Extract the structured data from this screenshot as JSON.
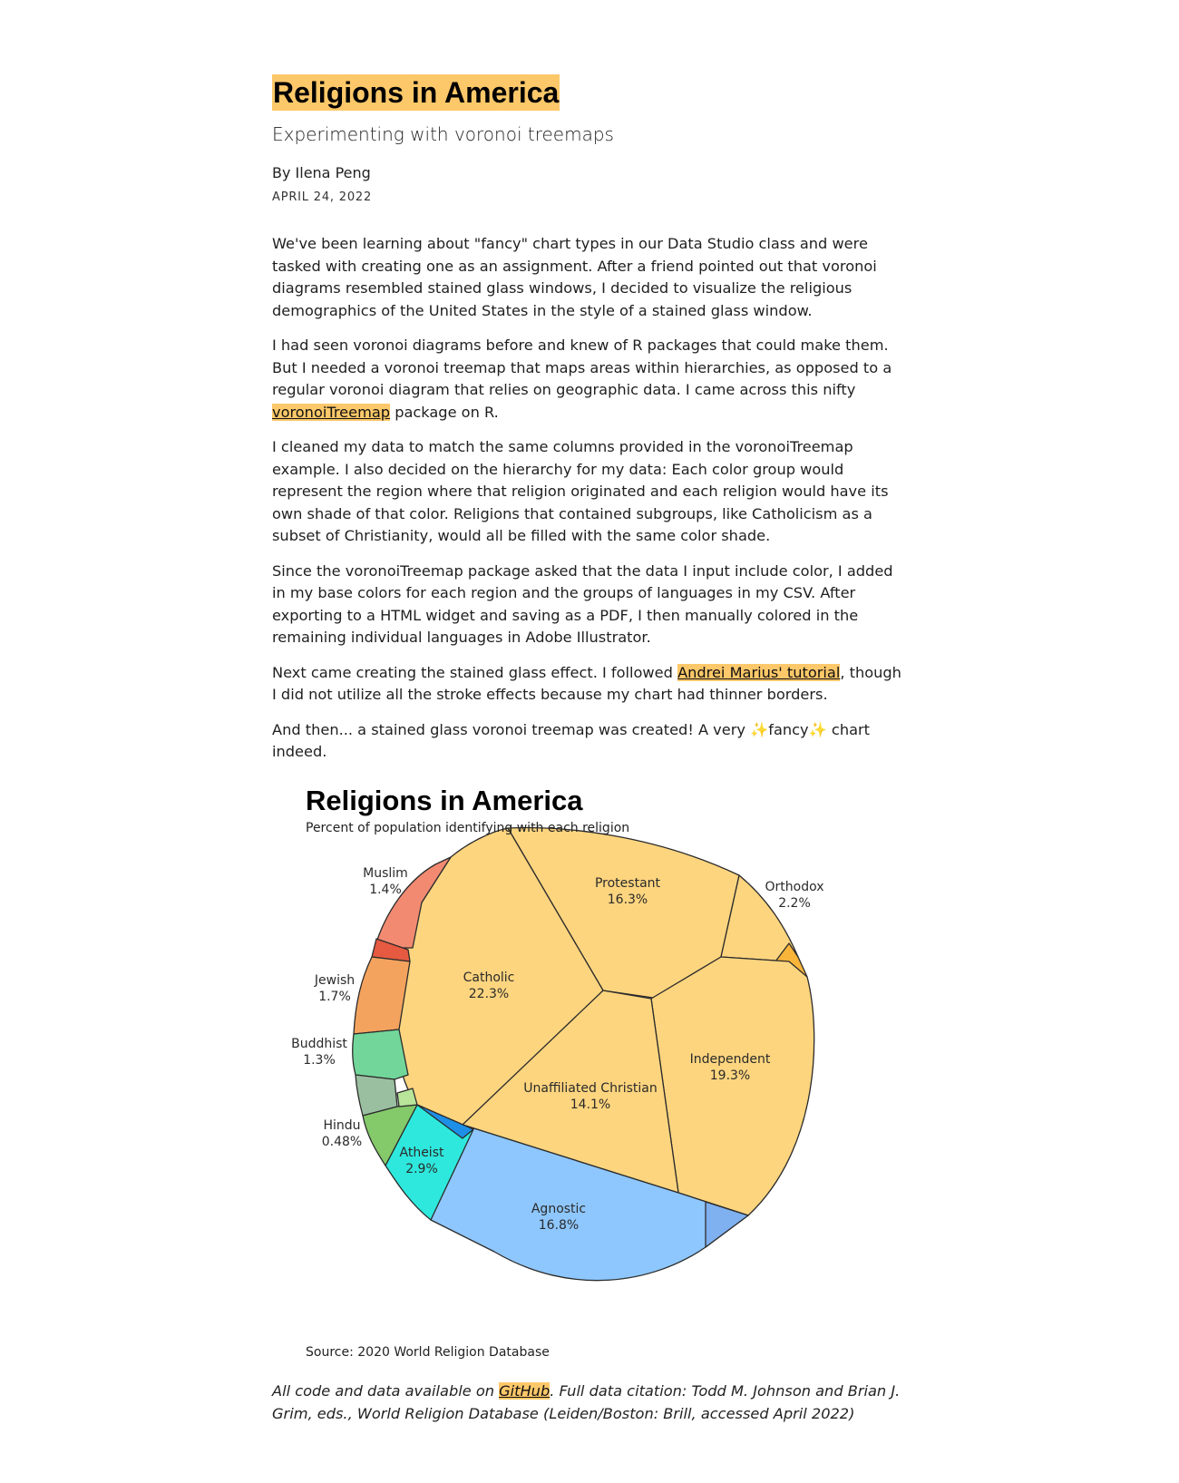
{
  "article": {
    "title": "Religions in America",
    "subtitle": "Experimenting with voronoi treemaps",
    "byline": "By Ilena Peng",
    "date": "APRIL 24, 2022",
    "p1": "We've been learning about \"fancy\" chart types in our Data Studio class and were tasked with creating one as an assignment. After a friend pointed out that voronoi diagrams resembled stained glass windows, I decided to visualize the religious demographics of the United States in the style of a stained glass window.",
    "p2_before": "I had seen voronoi diagrams before and knew of R packages that could make them. But I needed a voronoi treemap that maps areas within hierarchies, as opposed to a regular voronoi diagram that relies on geographic data. I came across this nifty ",
    "p2_link": "voronoiTreemap",
    "p2_after": " package on R.",
    "p3": "I cleaned my data to match the same columns provided in the voronoiTreemap example. I also decided on the hierarchy for my data: Each color group would represent the region where that religion originated and each religion would have its own shade of that color. Religions that contained subgroups, like Catholicism as a subset of Christianity, would all be filled with the same color shade.",
    "p4": "Since the voronoiTreemap package asked that the data I input include color, I added in my base colors for each region and the groups of languages in my CSV. After exporting to a HTML widget and saving as a PDF, I then manually colored in the remaining individual languages in Adobe Illustrator.",
    "p5_before": "Next came creating the stained glass effect. I followed ",
    "p5_link": "Andrei Marius' tutorial",
    "p5_after": ", though I did not utilize all the stroke effects because my chart had thinner borders.",
    "p6_before": "And then... a stained glass voronoi treemap was created! A very ",
    "p6_sparkle": "✨",
    "p6_fancy": "fancy",
    "p6_after": " chart indeed."
  },
  "figure": {
    "title": "Religions in America",
    "subtitle": "Percent of population identifying with each religion",
    "source": "Source: 2020 World Religion Database"
  },
  "footer": {
    "before": "All code and data available on ",
    "link": "GitHub",
    "after": ". Full data citation: Todd M. Johnson and Brian J. Grim, eds., World Religion Database (Leiden/Boston: Brill, accessed April 2022)"
  },
  "colors": {
    "highlight": "#fdc869",
    "christian": "#fdd57f",
    "agnostic": "#8ec7fd",
    "atheist": "#2ee8dd",
    "muslim": "#f28a72",
    "jewish": "#f4a35e",
    "buddhist": "#72d69a",
    "hindu": "#84c96a"
  },
  "chart_data": {
    "type": "voronoi-treemap",
    "title": "Religions in America",
    "subtitle": "Percent of population identifying with each religion",
    "unit": "%",
    "cells": [
      {
        "label": "Catholic",
        "value": 22.3
      },
      {
        "label": "Independent",
        "value": 19.3
      },
      {
        "label": "Agnostic",
        "value": 16.8
      },
      {
        "label": "Protestant",
        "value": 16.3
      },
      {
        "label": "Unaffiliated Christian",
        "value": 14.1
      },
      {
        "label": "Atheist",
        "value": 2.9
      },
      {
        "label": "Orthodox",
        "value": 2.2
      },
      {
        "label": "Jewish",
        "value": 1.7
      },
      {
        "label": "Muslim",
        "value": 1.4
      },
      {
        "label": "Buddhist",
        "value": 1.3
      },
      {
        "label": "Hindu",
        "value": 0.48
      }
    ],
    "value_labels": [
      "22.3%",
      "19.3%",
      "16.8%",
      "16.3%",
      "14.1%",
      "2.9%",
      "2.2%",
      "1.7%",
      "1.4%",
      "1.3%",
      "0.48%"
    ]
  }
}
